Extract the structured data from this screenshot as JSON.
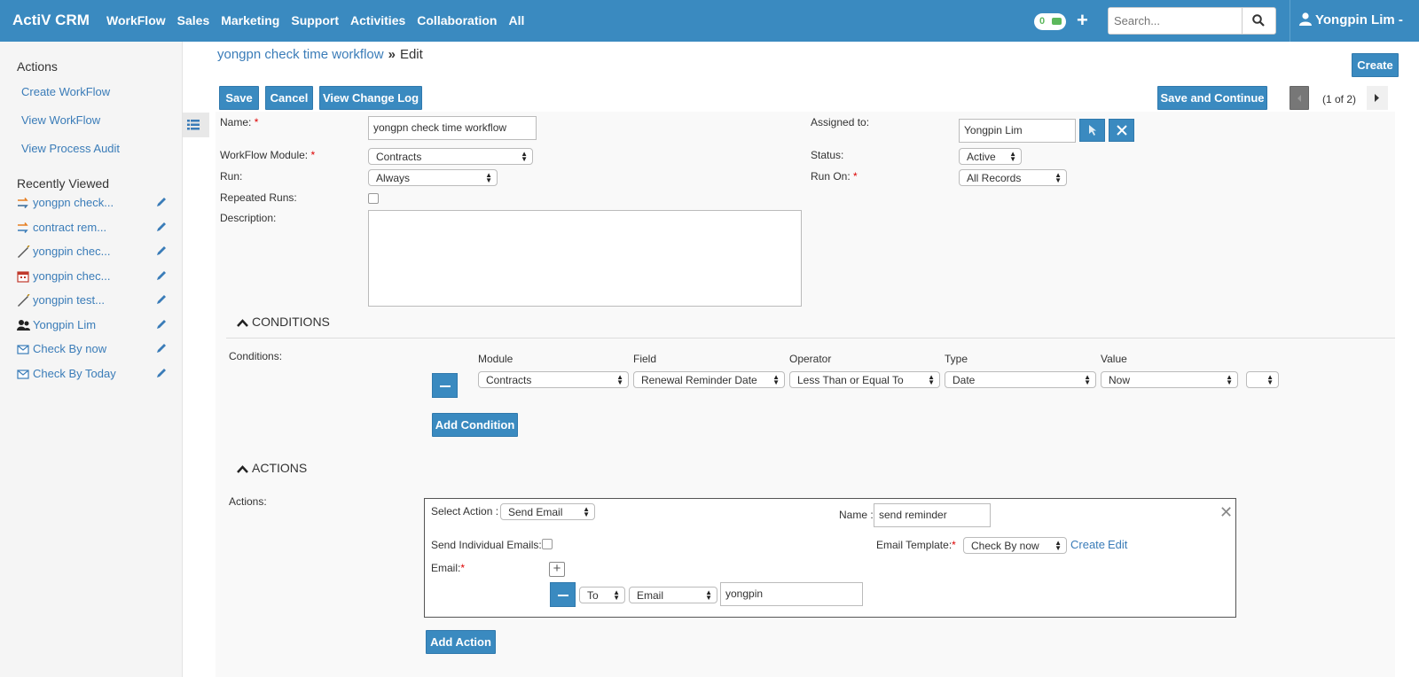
{
  "app": {
    "brand": "ActiV CRM"
  },
  "nav": {
    "items": [
      "WorkFlow",
      "Sales",
      "Marketing",
      "Support",
      "Activities",
      "Collaboration",
      "All"
    ],
    "notifications": "0",
    "search_placeholder": "Search...",
    "user": "Yongpin Lim -"
  },
  "sidebar": {
    "actions_heading": "Actions",
    "actions": [
      "Create WorkFlow",
      "View WorkFlow",
      "View Process Audit"
    ],
    "recent_heading": "Recently Viewed",
    "recent": [
      {
        "label": "yongpn check...",
        "icon": "workflow-icon"
      },
      {
        "label": "contract rem...",
        "icon": "workflow-icon"
      },
      {
        "label": "yongpin chec...",
        "icon": "pen-icon"
      },
      {
        "label": "yongpin chec...",
        "icon": "calendar-icon"
      },
      {
        "label": "yongpin test...",
        "icon": "pen-icon"
      },
      {
        "label": "Yongpin Lim",
        "icon": "users-icon"
      },
      {
        "label": "Check By now",
        "icon": "envelope-icon"
      },
      {
        "label": "Check By Today",
        "icon": "envelope-icon"
      }
    ]
  },
  "breadcrumb": {
    "record": "yongpn check time workflow",
    "separator": "»",
    "current": "Edit"
  },
  "toolbar": {
    "create": "Create",
    "save": "Save",
    "cancel": "Cancel",
    "change_log": "View Change Log",
    "save_continue": "Save and Continue",
    "pagination": "(1 of 2)"
  },
  "form": {
    "name_label": "Name:",
    "name_value": "yongpn check time workflow",
    "module_label": "WorkFlow Module:",
    "module_value": "Contracts",
    "run_label": "Run:",
    "run_value": "Always",
    "repeated_label": "Repeated Runs:",
    "description_label": "Description:",
    "assigned_label": "Assigned to:",
    "assigned_value": "Yongpin Lim",
    "status_label": "Status:",
    "status_value": "Active",
    "run_on_label": "Run On:",
    "run_on_value": "All Records"
  },
  "conditions": {
    "heading": "CONDITIONS",
    "label": "Conditions:",
    "columns": [
      "Module",
      "Field",
      "Operator",
      "Type",
      "Value"
    ],
    "row": {
      "module": "Contracts",
      "field": "Renewal Reminder Date",
      "operator": "Less Than or Equal To",
      "type": "Date",
      "value": "Now",
      "extra": ""
    },
    "add_button": "Add Condition"
  },
  "actions": {
    "heading": "ACTIONS",
    "label": "Actions:",
    "select_action_label": "Select Action :",
    "select_action_value": "Send Email",
    "name_label": "Name :",
    "name_value": "send reminder",
    "individual_label": "Send Individual Emails:",
    "template_label": "Email Template:",
    "template_value": "Check By now",
    "template_create": "Create",
    "template_edit": "Edit",
    "email_label": "Email:",
    "recipient_type": "To",
    "recipient_field": "Email",
    "recipient_value": "yongpin",
    "add_button": "Add Action"
  }
}
